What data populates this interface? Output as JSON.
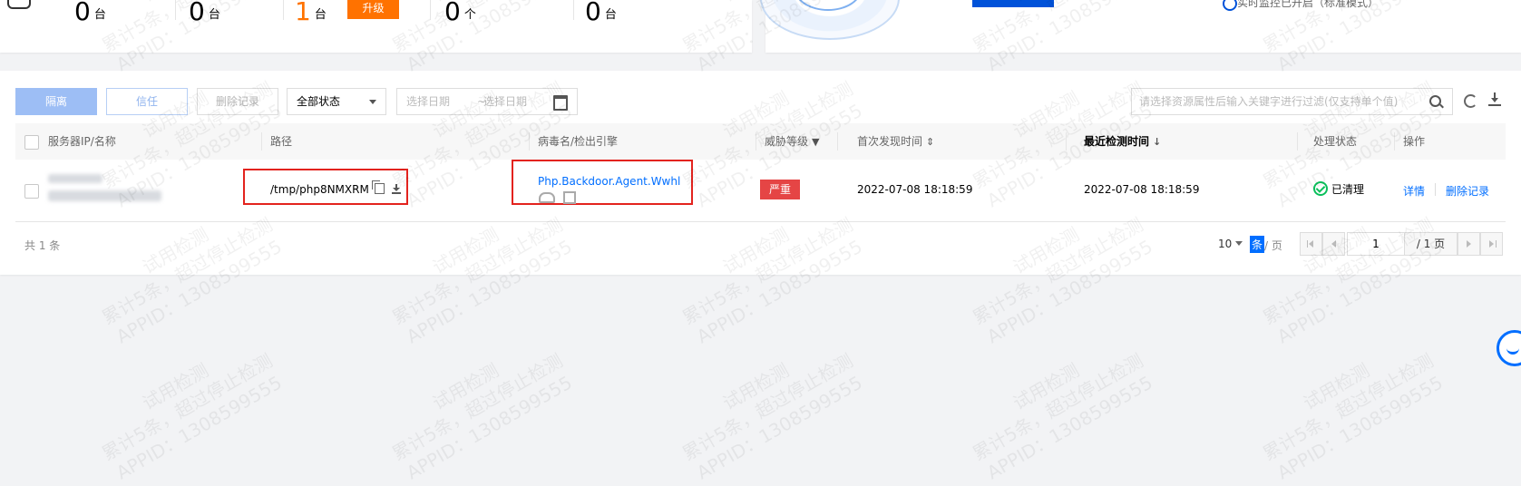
{
  "stats": [
    {
      "value": "0",
      "unit": "台"
    },
    {
      "value": "0",
      "unit": "台"
    },
    {
      "value": "1",
      "unit": "台",
      "badge": "升级"
    },
    {
      "value": "0",
      "unit": "个"
    },
    {
      "value": "0",
      "unit": "台"
    }
  ],
  "monitor": {
    "text": "实时监控已开启（标准模式）"
  },
  "toolbar": {
    "isolate_label": "隔离",
    "trust_label": "信任",
    "delete_label": "删除记录",
    "status_select": "全部状态",
    "date_start_placeholder": "选择日期",
    "date_end_placeholder": "选择日期",
    "date_separator": "~",
    "search_placeholder": "请选择资源属性后输入关键字进行过滤(仅支持单个值)"
  },
  "table": {
    "columns": {
      "server": "服务器IP/名称",
      "path": "路径",
      "virus": "病毒名/检出引擎",
      "threat": "威胁等级",
      "first_found": "首次发现时间",
      "last_scan": "最近检测时间",
      "status": "处理状态",
      "actions": "操作"
    },
    "rows": [
      {
        "path": "/tmp/php8NMXRM",
        "virus": "Php.Backdoor.Agent.Wwhl",
        "threat": "严重",
        "first_found": "2022-07-08 18:18:59",
        "last_scan": "2022-07-08 18:18:59",
        "status": "已清理",
        "action_detail": "详情",
        "action_delete": "删除记录"
      }
    ]
  },
  "footer": {
    "total": "共 1 条",
    "page_size": "10",
    "page_size_unit": "条",
    "page_size_suffix": "/ 页",
    "current_page": "1",
    "total_pages": "/ 1 页"
  },
  "watermark": {
    "line1": "累计5条，超过停止检测",
    "line2": "APPID：1308599555",
    "line3": "试用检测"
  },
  "colors": {
    "primary": "#006eff",
    "warning": "#ff7200",
    "danger": "#e54545",
    "success": "#0abf5b",
    "highlight_frame": "#e3231e"
  }
}
